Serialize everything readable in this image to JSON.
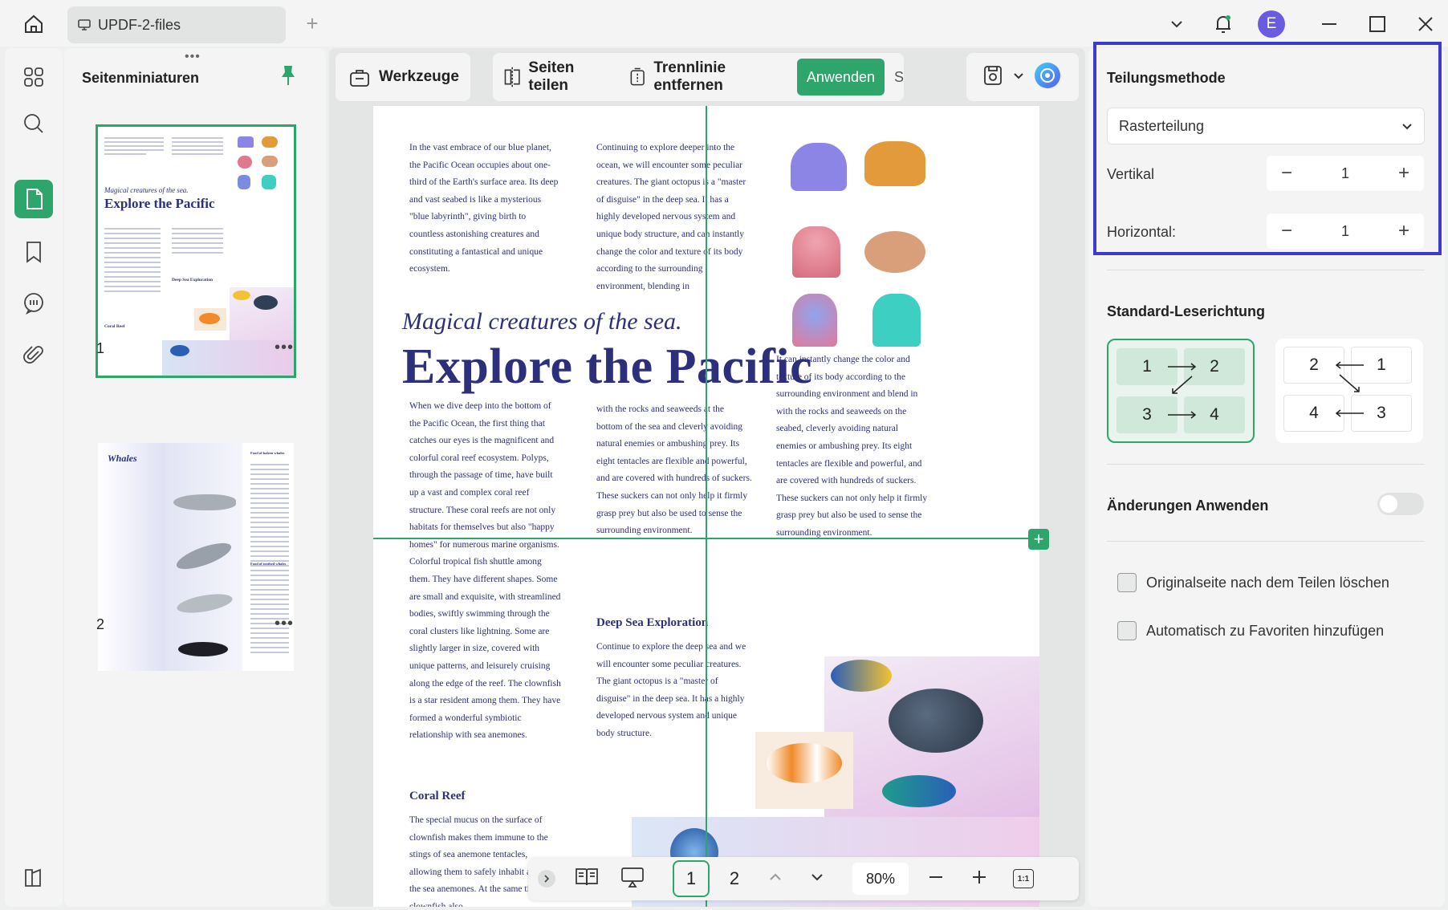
{
  "titlebar": {
    "tab_title": "UPDF-2-files",
    "avatar_initial": "E"
  },
  "thumbnails": {
    "title": "Seitenminiaturen",
    "grip": "•••",
    "more": "•••",
    "pages": [
      {
        "number": "1"
      },
      {
        "number": "2"
      }
    ],
    "thumb1": {
      "magical": "Magical creatures of the sea.",
      "explore": "Explore the Pacific",
      "deep": "Deep Sea Exploration",
      "coral": "Coral Reef"
    },
    "thumb2": {
      "whales": "Whales",
      "food1": "Food of baleen whales",
      "food2": "Food of toothed whales"
    }
  },
  "toolbar": {
    "werkzeuge": "Werkzeuge",
    "seiten_teilen": "Seiten teilen",
    "trennlinie": "Trennlinie entfernen",
    "anwenden": "Anwenden",
    "overflow": "S"
  },
  "document": {
    "col1_para": "In the vast embrace of our blue planet, the Pacific Ocean occupies about one-third of the Earth's surface area. Its deep and vast seabed is like a mysterious \"blue labyrinth\", giving birth to countless astonishing creatures and constituting a fantastical and unique ecosystem.",
    "col2_para": "Continuing to explore deeper into the ocean, we will encounter some peculiar creatures. The giant octopus is a \"master of disguise\" in the deep sea. It has a highly developed nervous system and unique body structure, and can instantly change the color and texture of its body according to the surrounding environment, blending in",
    "magical": "Magical creatures of the sea.",
    "explore": "Explore the Pacific",
    "col3_para": "It can instantly change the color and texture of its body according to the surrounding environment and blend in with the rocks and seaweeds on the seabed, cleverly avoiding natural enemies or ambushing prey. Its eight tentacles are flexible and powerful, and are covered with hundreds of suckers. These suckers can not only help it firmly grasp prey but also be used to sense the surrounding environment.",
    "col1_para2": "When we dive deep into the bottom of the Pacific Ocean, the first thing that catches our eyes is the magnificent and colorful coral reef ecosystem. Polyps, through the passage of time, have built up a vast and complex coral reef structure. These coral reefs are not only habitats for themselves but also \"happy homes\" for numerous marine organisms. Colorful tropical fish shuttle among them. They have different shapes. Some are small and exquisite, with streamlined bodies, swiftly swimming through the coral clusters like lightning. Some are slightly larger in size, covered with unique patterns, and leisurely cruising along the edge of the reef. The clownfish is a star resident among them. They have formed a wonderful symbiotic relationship with sea anemones.",
    "col2_para2": "with the rocks and seaweeds at the bottom of the sea and cleverly avoiding natural enemies or ambushing prey. Its eight tentacles are flexible and powerful, and are covered with hundreds of suckers. These suckers can not only help it firmly grasp prey but also be used to sense the surrounding environment.",
    "deep_heading": "Deep Sea Exploration",
    "deep_para": "Continue to explore the deep sea and we will encounter some peculiar creatures. The giant octopus is a \"master of disguise\" in the deep sea. It has a highly developed nervous system and unique body structure.",
    "coral_heading": "Coral Reef",
    "coral_para": "The special mucus on the surface of clownfish makes them immune to the stings of sea anemone tentacles, allowing them to safely inhabit among the sea anemones. At the same time, clownfish also"
  },
  "bottombar": {
    "page1": "1",
    "page2": "2",
    "zoom": "80%",
    "fit": "1:1"
  },
  "rightpanel": {
    "teilungsmethode": "Teilungsmethode",
    "method_value": "Rasterteilung",
    "vertikal_label": "Vertikal",
    "vertikal_value": "1",
    "horizontal_label": "Horizontal:",
    "horizontal_value": "1",
    "leserichtung": "Standard-Leserichtung",
    "dir_left": [
      "1",
      "2",
      "3",
      "4"
    ],
    "dir_right": [
      "2",
      "1",
      "4",
      "3"
    ],
    "aenderungen": "Änderungen Anwenden",
    "opt1": "Originalseite nach dem Teilen löschen",
    "opt2": "Automatisch zu Favoriten hinzufügen"
  },
  "colors": {
    "accent": "#2ea56b",
    "highlight": "#3b3bd1",
    "doc_text": "#2c2f7a",
    "avatar": "#6a5ce0"
  }
}
